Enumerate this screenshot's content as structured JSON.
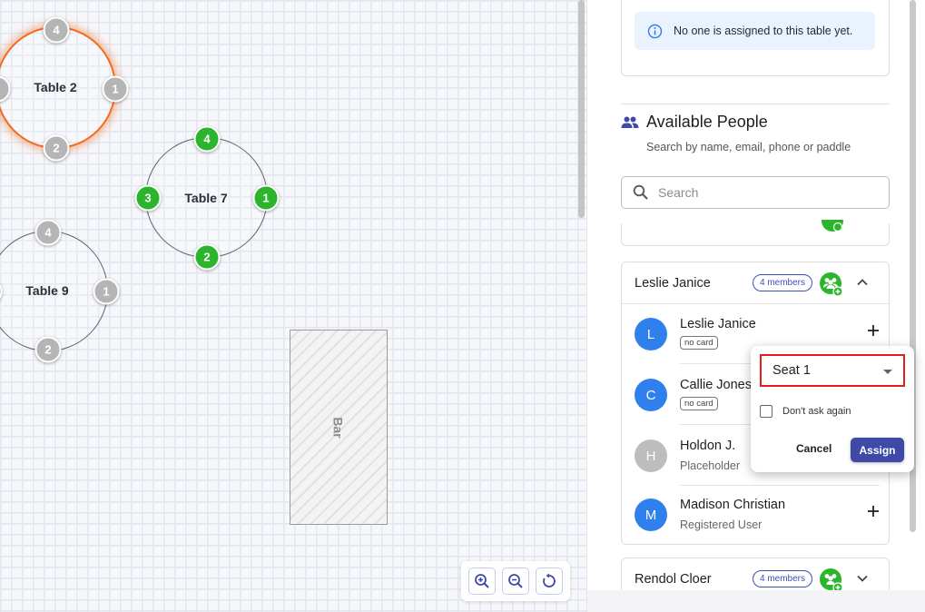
{
  "canvas": {
    "tables": [
      {
        "name": "Table 2",
        "selected": true,
        "seats": [
          "4",
          "1",
          "2",
          ""
        ]
      },
      {
        "name": "Table 7",
        "selected": false,
        "seats": [
          "4",
          "1",
          "2",
          "3"
        ]
      },
      {
        "name": "Table 9",
        "selected": false,
        "seats": [
          "4",
          "1",
          "2",
          ""
        ]
      }
    ],
    "bar_label": "Bar",
    "zoom_controls": [
      "zoom-in-icon",
      "zoom-out-icon",
      "reset-view-icon"
    ]
  },
  "panel": {
    "info_message": "No one is assigned to this table yet.",
    "available_title": "Available People",
    "available_subtitle": "Search by name, email, phone or paddle",
    "search": {
      "placeholder": "Search",
      "value": ""
    },
    "groups": [
      {
        "name": "Leslie Janice",
        "members_badge": "4 members",
        "expanded": true,
        "people": [
          {
            "name": "Leslie Janice",
            "initial": "L",
            "chip": "no card",
            "avatar_color": "#2f80ed"
          },
          {
            "name": "Callie Jones",
            "initial": "C",
            "chip": "no card",
            "avatar_color": "#2f80ed"
          },
          {
            "name": "Holdon J.",
            "initial": "H",
            "subtitle": "Placeholder",
            "avatar_color": "#bdbdbd"
          },
          {
            "name": "Madison Christian",
            "initial": "M",
            "subtitle": "Registered User",
            "avatar_color": "#2f80ed"
          }
        ]
      },
      {
        "name": "Rendol Cloer",
        "members_badge": "4 members",
        "expanded": false
      }
    ]
  },
  "popover": {
    "seat_value": "Seat 1",
    "dont_ask_label": "Don't ask again",
    "cancel_label": "Cancel",
    "assign_label": "Assign"
  },
  "colors": {
    "selected_table": "#f26b1d",
    "seat_occupied": "#2cb52c",
    "seat_empty": "#b5b5b5",
    "primary": "#3f4aa8",
    "avatar_blue": "#2f80ed",
    "highlight_border": "#e11d1d"
  }
}
